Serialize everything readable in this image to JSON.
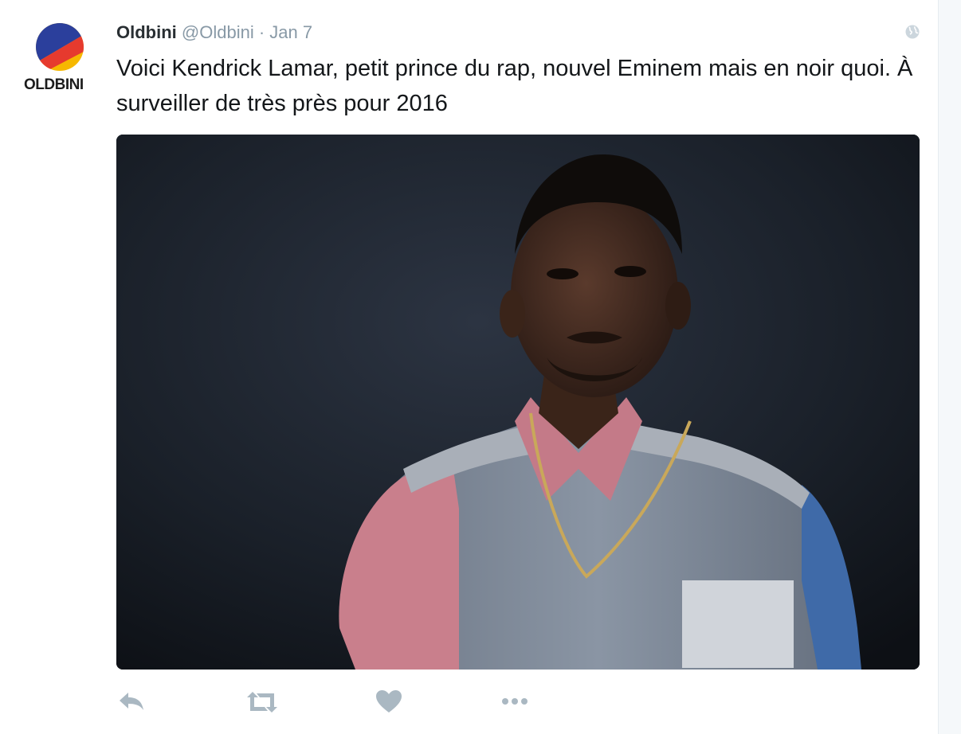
{
  "tweet": {
    "display_name": "Oldbini",
    "handle": "@Oldbini",
    "separator": "·",
    "date": "Jan 7",
    "text": "Voici Kendrick Lamar, petit prince du rap, nouvel Eminem mais en noir quoi. À surveiller de très près pour 2016",
    "avatar_wordmark": "OLDBINI",
    "media_icon": "photo-portrait"
  },
  "icons": {
    "globe": "globe-icon",
    "reply": "reply-icon",
    "retweet": "retweet-icon",
    "like": "heart-icon",
    "more": "more-icon"
  },
  "colors": {
    "name": "#292f33",
    "meta": "#8899a6",
    "text": "#14171a",
    "action_icons": "#aab8c2",
    "logo_red": "#e63a2e",
    "logo_blue": "#2b3f9c",
    "logo_yellow": "#f6b800"
  }
}
